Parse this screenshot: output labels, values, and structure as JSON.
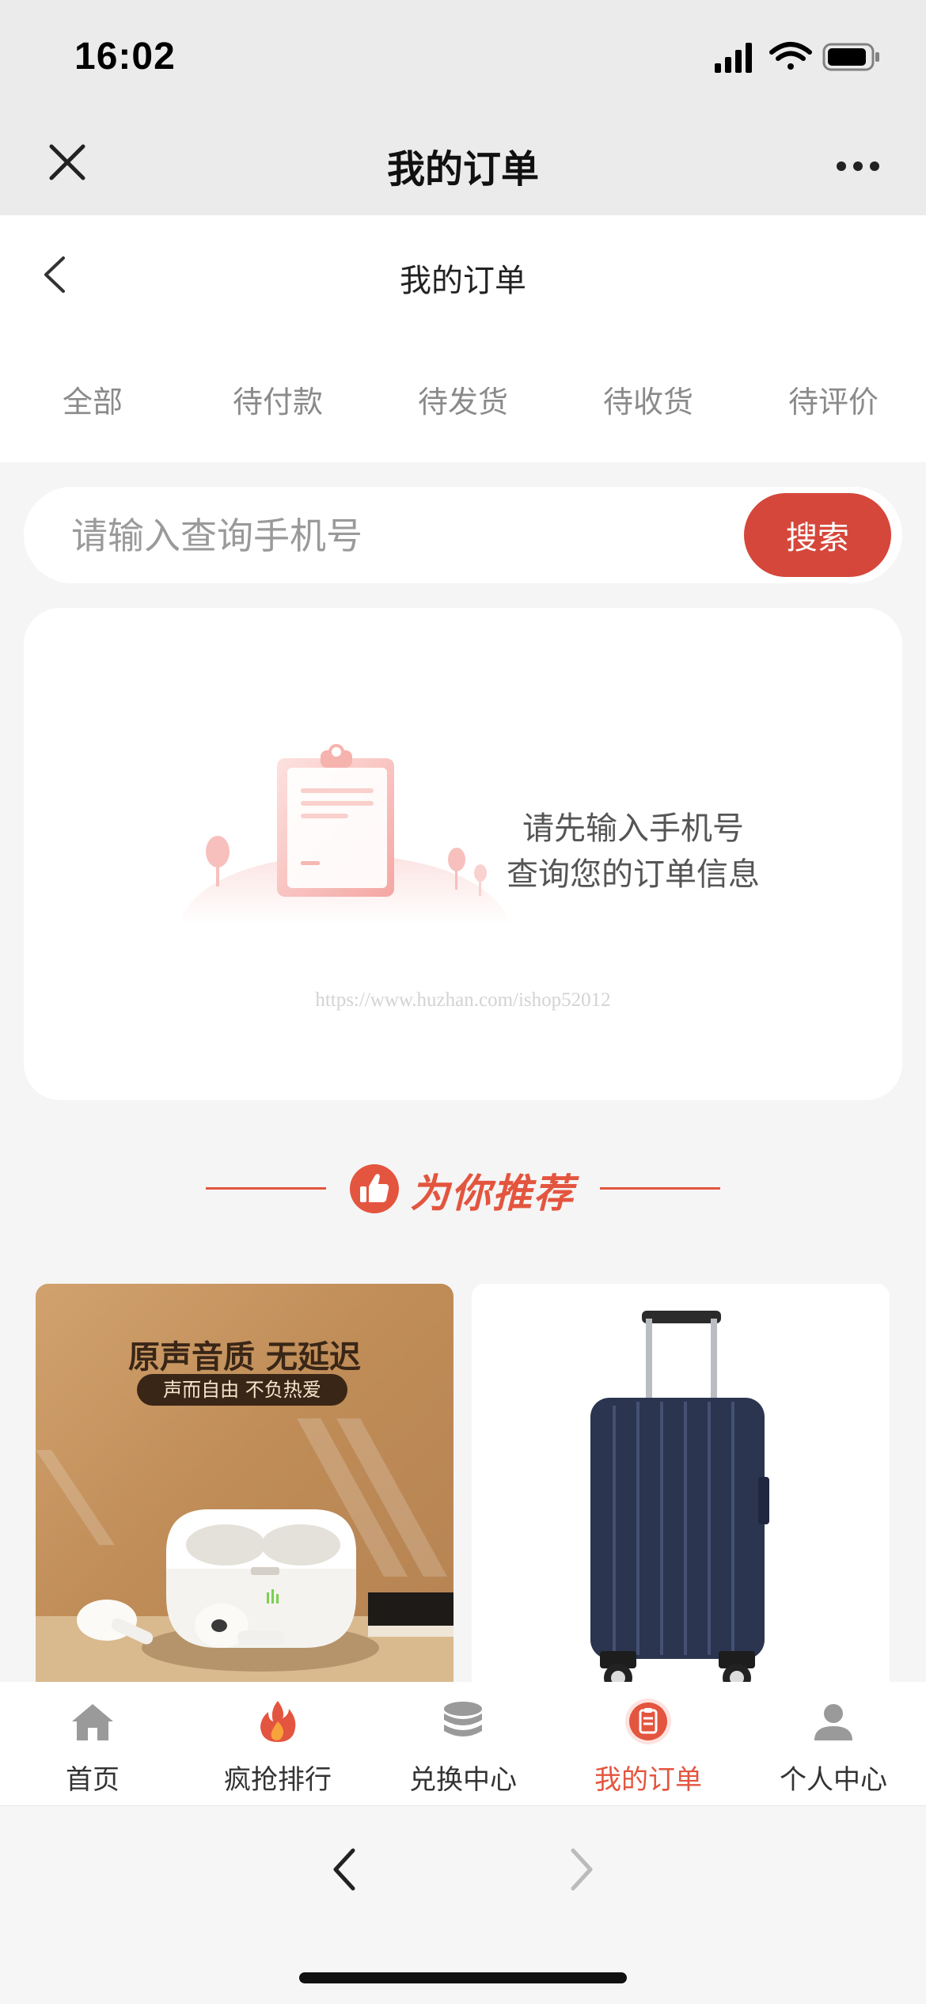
{
  "status_bar": {
    "time": "16:02",
    "icons": [
      "signal-icon",
      "wifi-icon",
      "battery-icon"
    ]
  },
  "nav_bar": {
    "title": "我的订单",
    "close_icon": "close-icon",
    "more_icon": "more-icon"
  },
  "page": {
    "title": "我的订单",
    "back_icon": "chevron-left-icon"
  },
  "order_tabs": [
    {
      "label": "全部"
    },
    {
      "label": "待付款"
    },
    {
      "label": "待发货"
    },
    {
      "label": "待收货"
    },
    {
      "label": "待评价"
    }
  ],
  "search": {
    "placeholder": "请输入查询手机号",
    "value": "",
    "button_label": "搜索"
  },
  "empty_state": {
    "line1": "请先输入手机号",
    "line2": "查询您的订单信息",
    "watermark": "https://www.huzhan.com/ishop52012"
  },
  "recommend": {
    "title": "为你推荐",
    "icon": "thumbs-up-icon"
  },
  "products": [
    {
      "headline": "原声音质 无延迟",
      "tag": "声而自由 不负热爱",
      "image": "earbuds-image"
    },
    {
      "headline": "",
      "tag": "",
      "image": "luggage-image"
    }
  ],
  "tab_bar": [
    {
      "label": "首页",
      "icon": "home-icon",
      "active": false
    },
    {
      "label": "疯抢排行",
      "icon": "fire-icon",
      "active": false
    },
    {
      "label": "兑换中心",
      "icon": "coins-icon",
      "active": false
    },
    {
      "label": "我的订单",
      "icon": "order-icon",
      "active": true
    },
    {
      "label": "个人中心",
      "icon": "user-icon",
      "active": false
    }
  ],
  "colors": {
    "accent": "#e4553f",
    "search_button": "#d5473a",
    "background": "#f5f5f5",
    "nav_background": "#ebebeb"
  }
}
